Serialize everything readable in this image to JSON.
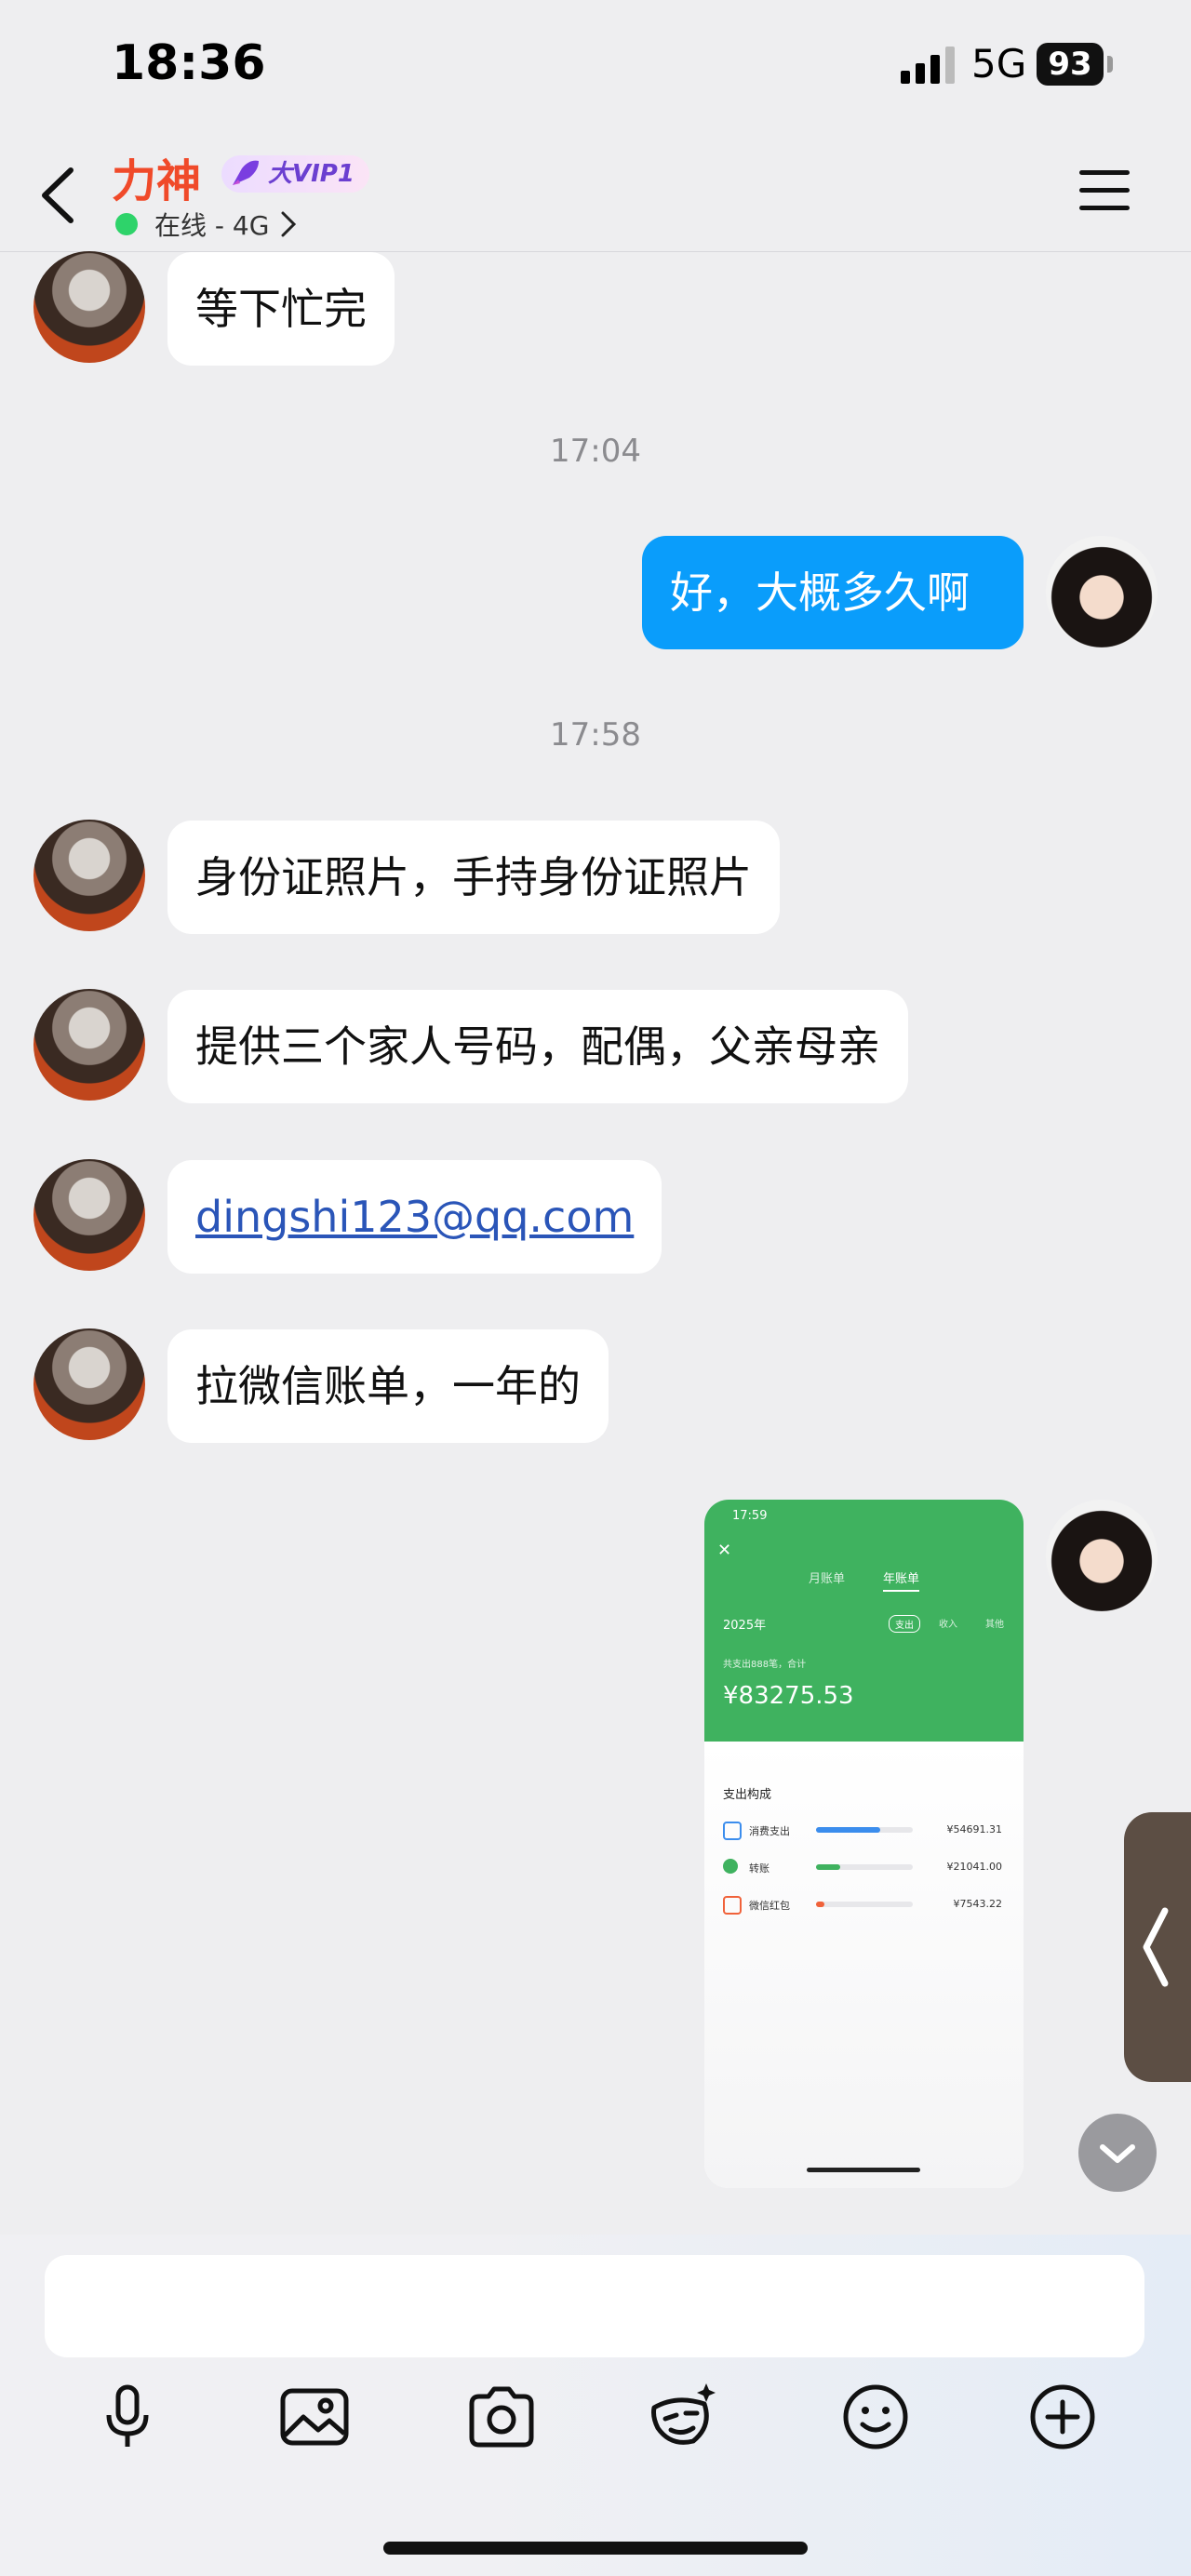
{
  "status_bar": {
    "time": "18:36",
    "network": "5G",
    "battery": "93"
  },
  "header": {
    "contact_name": "力神",
    "vip_label": "大VIP1",
    "online_status": "在线 - 4G"
  },
  "messages": [
    {
      "from": "peer",
      "type": "text",
      "text": "等下忙完"
    },
    {
      "type": "time",
      "text": "17:04"
    },
    {
      "from": "me",
      "type": "text",
      "text": "好，大概多久啊"
    },
    {
      "type": "time",
      "text": "17:58"
    },
    {
      "from": "peer",
      "type": "text",
      "text": "身份证照片，手持身份证照片"
    },
    {
      "from": "peer",
      "type": "text",
      "text": "提供三个家人号码，配偶，父亲母亲"
    },
    {
      "from": "peer",
      "type": "link",
      "text": "dingshi123@qq.com"
    },
    {
      "from": "peer",
      "type": "text",
      "text": "拉微信账单，一年的"
    },
    {
      "from": "me",
      "type": "image"
    }
  ],
  "screenshot": {
    "time": "17:59",
    "tab_month": "月账单",
    "tab_year": "年账单",
    "year_select": "2025年",
    "filter_expense": "支出",
    "filter_income": "收入",
    "filter_other": "其他",
    "summary_text": "共支出888笔，合计",
    "total": "¥83275.53",
    "section_title": "支出构成",
    "rows": [
      {
        "label": "消费支出",
        "value": "¥54691.31",
        "ratio": 0.66,
        "color": "#3b8ded"
      },
      {
        "label": "转账",
        "value": "¥21041.00",
        "ratio": 0.25,
        "color": "#3fb25f"
      },
      {
        "label": "微信红包",
        "value": "¥7543.22",
        "ratio": 0.09,
        "color": "#f0623a"
      }
    ]
  },
  "input": {
    "placeholder": ""
  },
  "toolbar": [
    "microphone-icon",
    "image-icon",
    "camera-icon",
    "ai-mask-icon",
    "emoji-icon",
    "plus-icon"
  ]
}
